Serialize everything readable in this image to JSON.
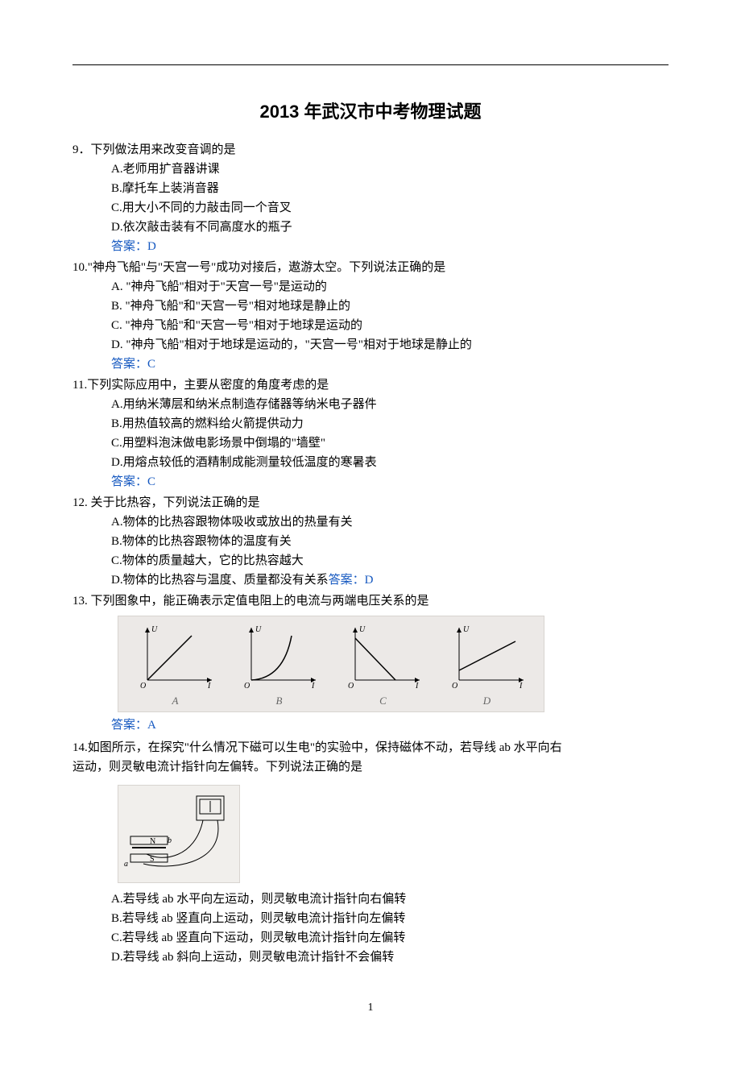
{
  "title": "2013 年武汉市中考物理试题",
  "page_number": "1",
  "q9": {
    "stem": "9．下列做法用来改变音调的是",
    "A": "A.老师用扩音器讲课",
    "B": "B.摩托车上装消音器",
    "C": "C.用大小不同的力敲击同一个音叉",
    "D": "D.依次敲击装有不同高度水的瓶子",
    "answer": "答案：D"
  },
  "q10": {
    "stem": "10.\"神舟飞船\"与\"天宫一号\"成功对接后，遨游太空。下列说法正确的是",
    "A": "A. \"神舟飞船\"相对于\"天宫一号\"是运动的",
    "B": "B. \"神舟飞船\"和\"天宫一号\"相对地球是静止的",
    "C": "C. \"神舟飞船\"和\"天宫一号\"相对于地球是运动的",
    "D": "D. \"神舟飞船\"相对于地球是运动的，\"天宫一号\"相对于地球是静止的",
    "answer": "答案：C"
  },
  "q11": {
    "stem": "11.下列实际应用中，主要从密度的角度考虑的是",
    "A": "A.用纳米薄层和纳米点制造存储器等纳米电子器件",
    "B": "B.用热值较高的燃料给火箭提供动力",
    "C": "C.用塑料泡沫做电影场景中倒塌的\"墙壁\"",
    "D": "D.用熔点较低的酒精制成能测量较低温度的寒暑表",
    "answer": "答案：C"
  },
  "q12": {
    "stem": "12. 关于比热容，下列说法正确的是",
    "A": "A.物体的比热容跟物体吸收或放出的热量有关",
    "B": "B.物体的比热容跟物体的温度有关",
    "C": "C.物体的质量越大，它的比热容越大",
    "D": "D.物体的比热容与温度、质量都没有关系",
    "answer": "答案：D"
  },
  "q13": {
    "stem": "13. 下列图象中，能正确表示定值电阻上的电流与两端电压关系的是",
    "answer": "答案：A",
    "graphs": {
      "A": "A",
      "B": "B",
      "C": "C",
      "D": "D"
    }
  },
  "q14": {
    "stem_l1": "14.如图所示，在探究\"什么情况下磁可以生电\"的实验中，保持磁体不动，若导线 ab 水平向右",
    "stem_l2": "运动，则灵敏电流计指针向左偏转。下列说法正确的是",
    "A": "A.若导线 ab 水平向左运动，则灵敏电流计指针向右偏转",
    "B": "B.若导线 ab 竖直向上运动，则灵敏电流计指针向左偏转",
    "C": "C.若导线 ab 竖直向下运动，则灵敏电流计指针向左偏转",
    "D": "D.若导线 ab 斜向上运动，则灵敏电流计指针不会偏转"
  },
  "chart_data": [
    {
      "type": "line",
      "label": "A",
      "xlabel": "I",
      "ylabel": "U",
      "x": [
        0,
        1
      ],
      "y": [
        0,
        1
      ],
      "note": "straight line through origin, positive slope"
    },
    {
      "type": "line",
      "label": "B",
      "xlabel": "I",
      "ylabel": "U",
      "x": [
        0,
        1
      ],
      "y": [
        0,
        1
      ],
      "note": "concave-up curve through origin (non-linear increasing)"
    },
    {
      "type": "line",
      "label": "C",
      "xlabel": "I",
      "ylabel": "U",
      "x": [
        0,
        1
      ],
      "y": [
        1,
        0
      ],
      "note": "straight line, positive intercept, negative slope"
    },
    {
      "type": "line",
      "label": "D",
      "xlabel": "I",
      "ylabel": "U",
      "x": [
        0,
        1
      ],
      "y": [
        0.2,
        1
      ],
      "note": "straight line with positive y-intercept and positive slope"
    }
  ]
}
